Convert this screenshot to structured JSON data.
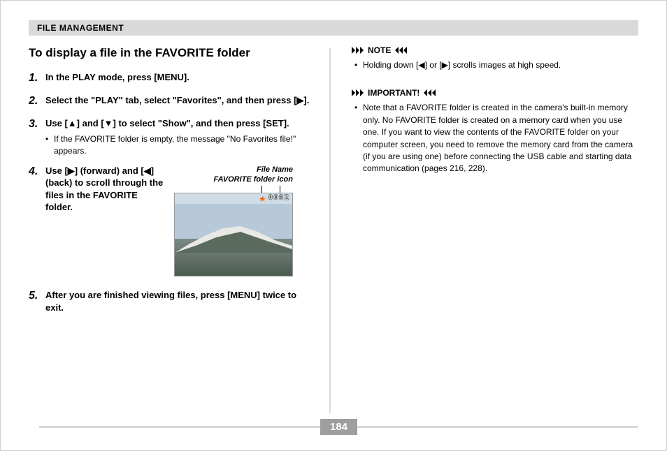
{
  "header": {
    "section": "FILE MANAGEMENT"
  },
  "title": "To display a file in the FAVORITE folder",
  "steps": [
    {
      "num": "1.",
      "text": "In the PLAY mode, press [MENU]."
    },
    {
      "num": "2.",
      "text": "Select the \"PLAY\" tab, select \"Favorites\", and then press [▶]."
    },
    {
      "num": "3.",
      "text": "Use [▲] and [▼] to select \"Show\", and then press [SET].",
      "sub": "If the FAVORITE folder is empty, the message \"No Favorites file!\" appears."
    },
    {
      "num": "4.",
      "text": "Use [▶] (forward) and [◀] (back) to scroll through the files in the FAVORITE folder."
    },
    {
      "num": "5.",
      "text": "After you are finished viewing files, press [MENU] twice to exit."
    }
  ],
  "figure": {
    "label_file_name": "File Name",
    "label_fav_icon": "FAVORITE folder icon",
    "file_number": "0002"
  },
  "note": {
    "heading": "NOTE",
    "text": "Holding down [◀] or [▶] scrolls images at high speed."
  },
  "important": {
    "heading": "IMPORTANT!",
    "text": "Note that a FAVORITE folder is created in the camera's built-in memory only. No FAVORITE folder is created on a memory card when you use one. If you want to view the contents of the FAVORITE folder on your computer screen, you need to remove the memory card from the camera (if you are using one) before connecting the USB cable and starting data communication (pages 216, 228)."
  },
  "page_number": "184"
}
